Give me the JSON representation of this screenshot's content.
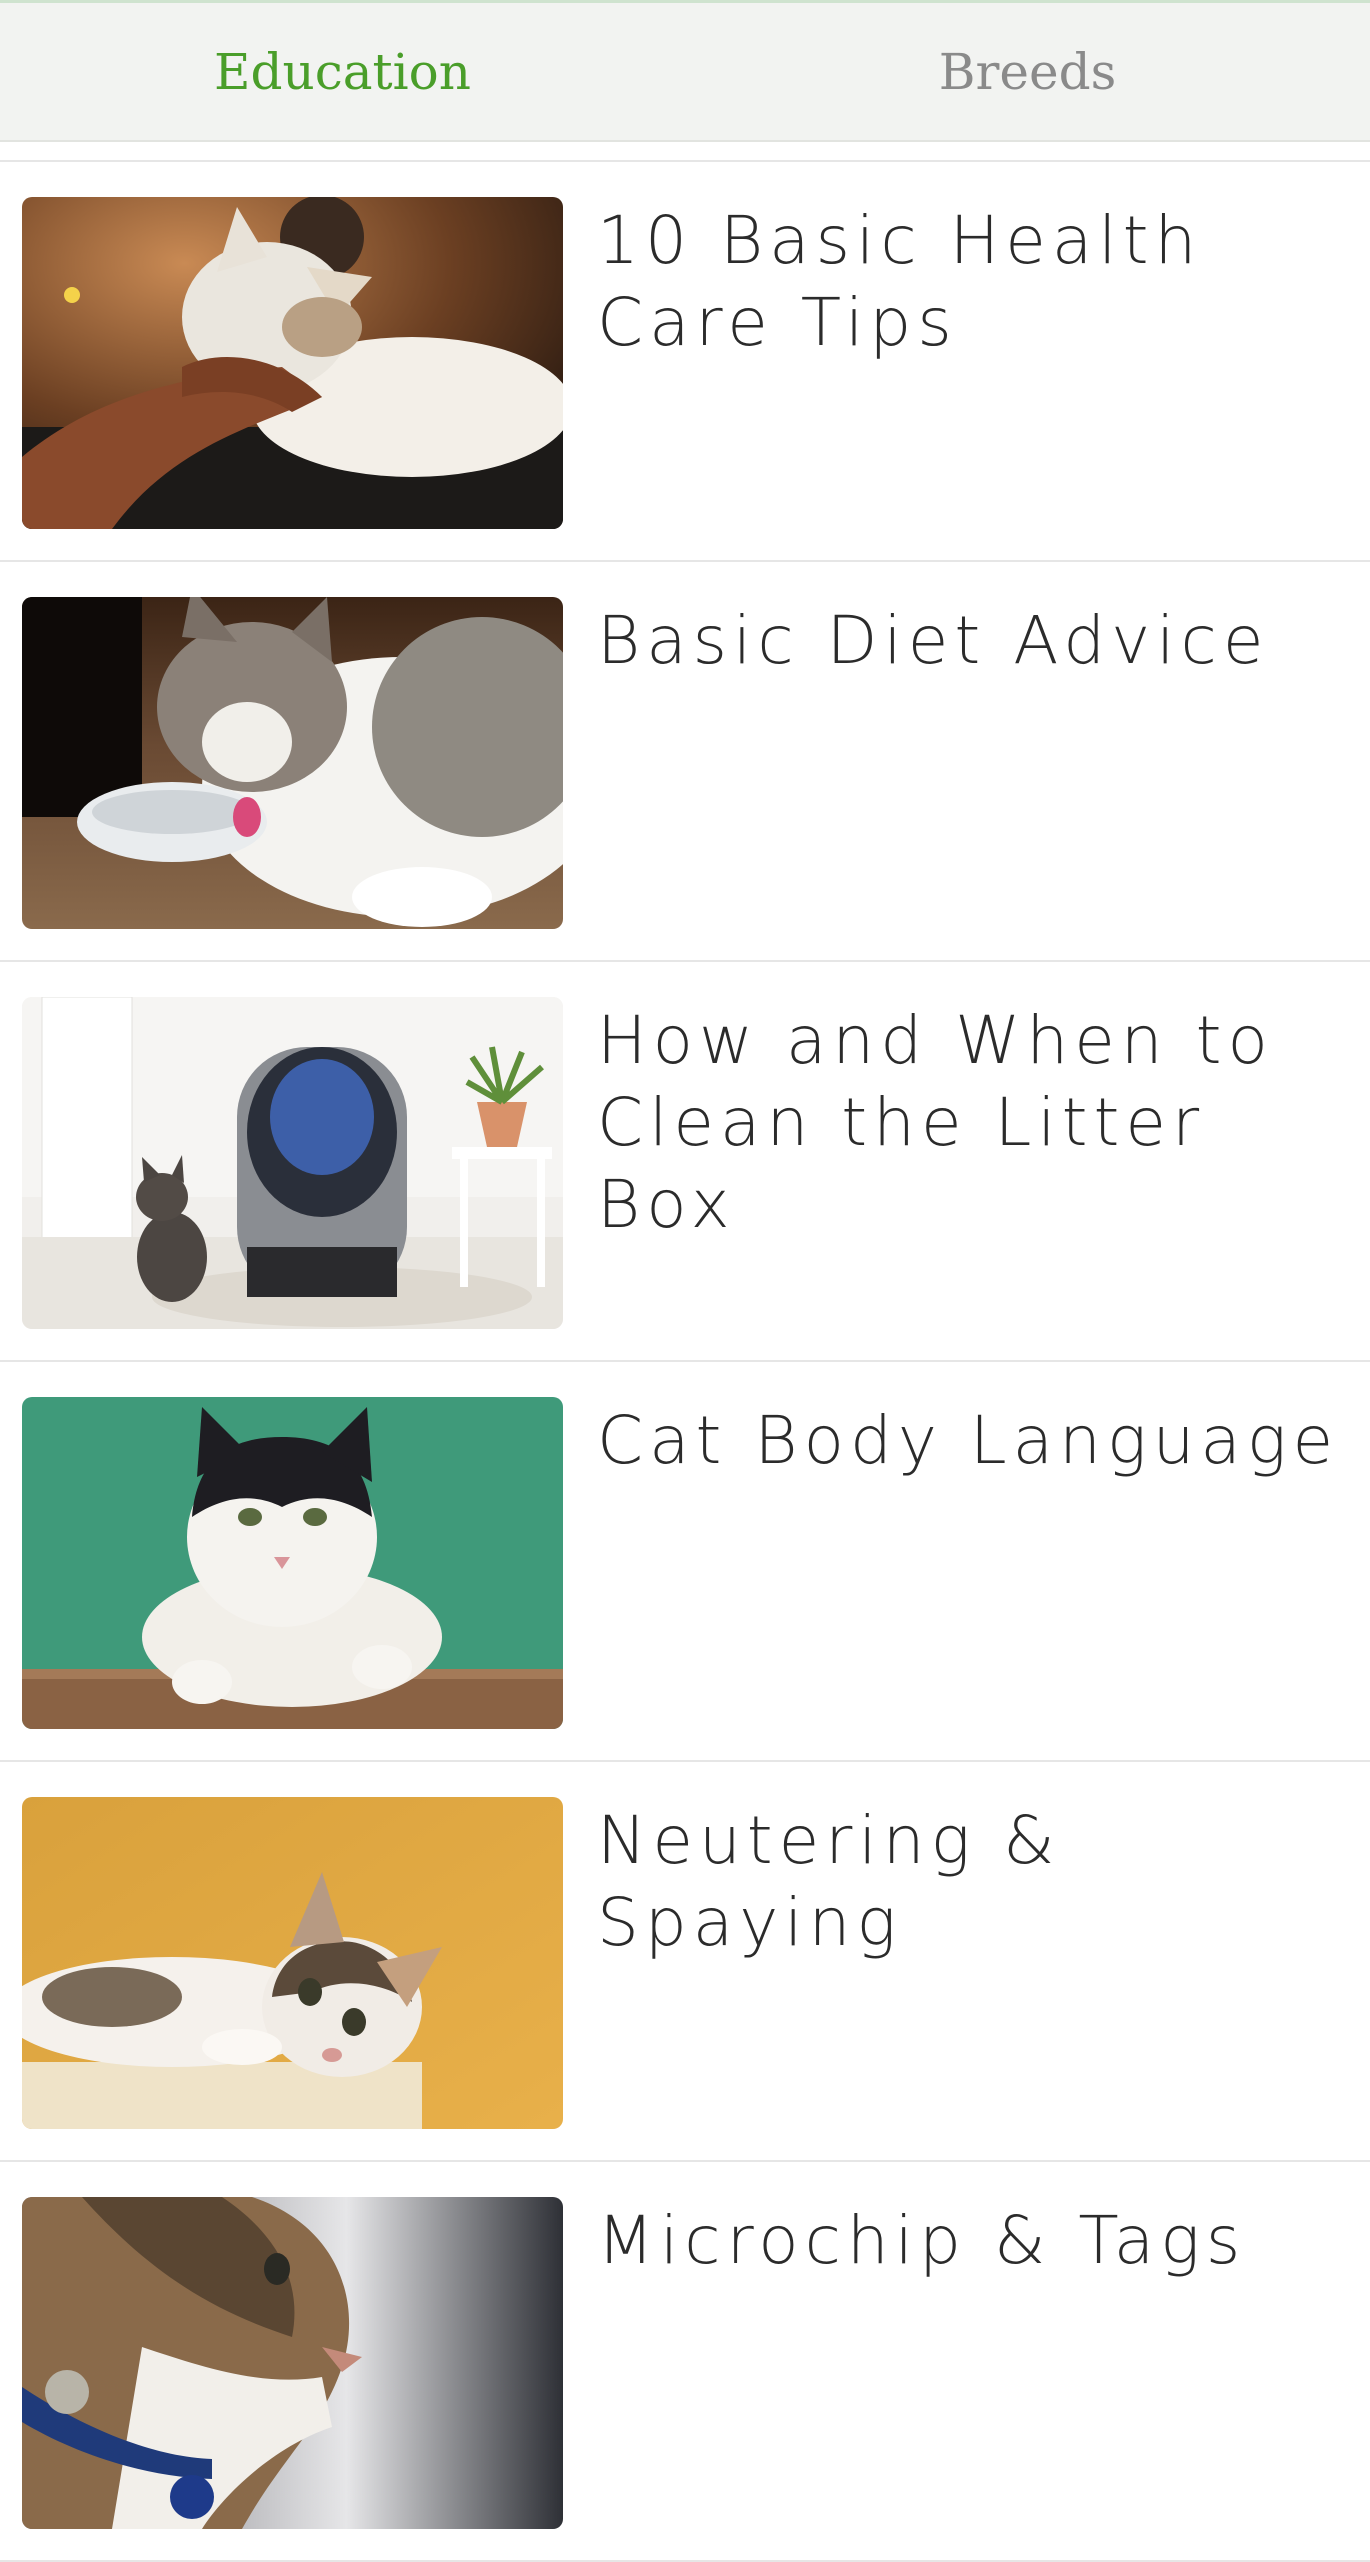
{
  "tabs": [
    {
      "label": "Education",
      "active": true
    },
    {
      "label": "Breeds",
      "active": false
    }
  ],
  "colors": {
    "accent": "#4a9e2a",
    "inactive_tab": "#8a8a8a",
    "tab_bar_bg": "#f2f3f1",
    "title_text": "#2b2b2b"
  },
  "articles": [
    {
      "title": "10 Basic Health Care Tips",
      "image": "cat-being-petted-photo"
    },
    {
      "title": "Basic Diet Advice",
      "image": "cat-eating-from-bowl-photo"
    },
    {
      "title": "How and When to Clean the Litter Box",
      "image": "cat-and-litter-robot-photo"
    },
    {
      "title": "Cat Body Language",
      "image": "cat-on-green-background-photo"
    },
    {
      "title": "Neutering & Spaying",
      "image": "calico-kitten-photo"
    },
    {
      "title": "Microchip & Tags",
      "image": "cat-with-collar-tag-photo"
    }
  ]
}
